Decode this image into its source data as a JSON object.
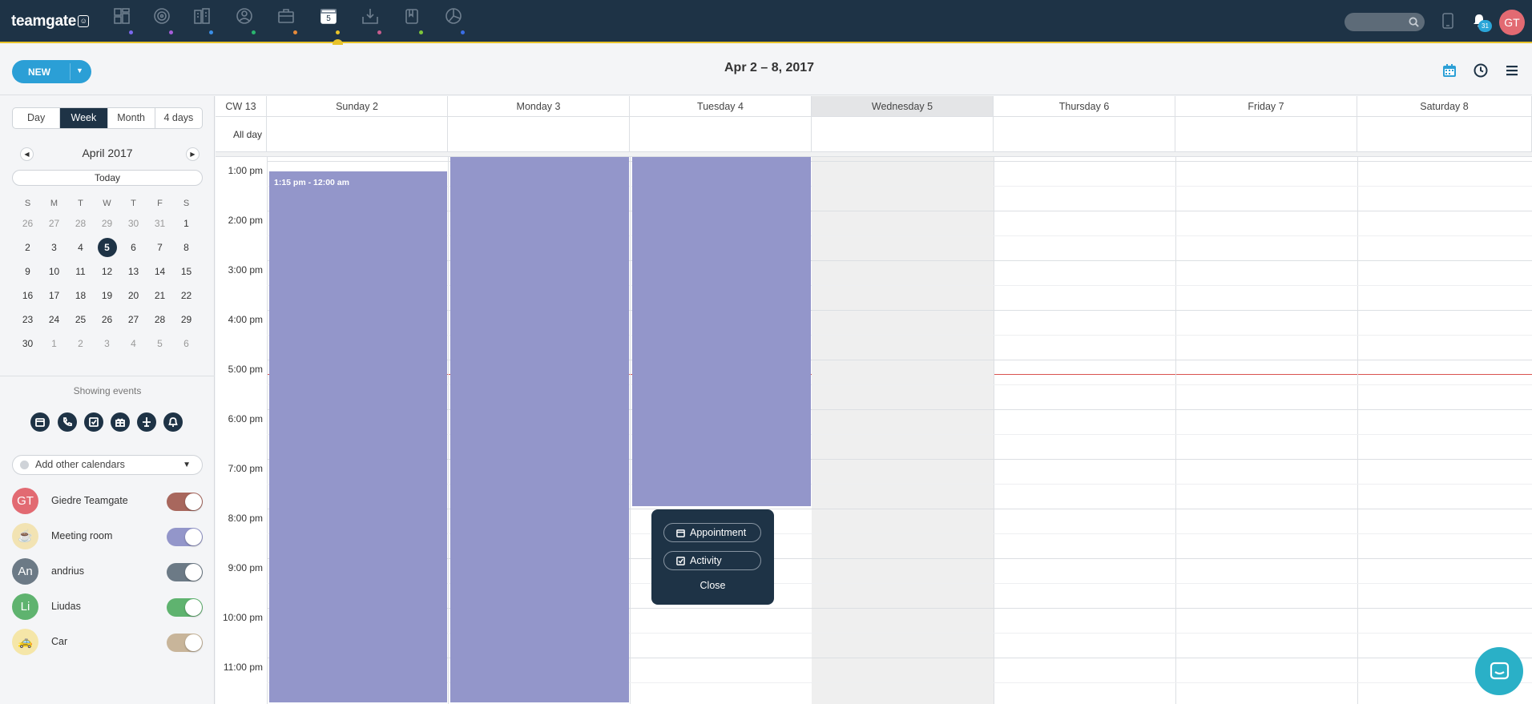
{
  "app": {
    "logo": "teamgate",
    "logo_badge": "☺"
  },
  "nav": {
    "icons": [
      {
        "name": "dashboard-icon",
        "dot": "#7b68ee"
      },
      {
        "name": "target-icon",
        "dot": "#a65edb"
      },
      {
        "name": "companies-icon",
        "dot": "#3a8ee6"
      },
      {
        "name": "people-icon",
        "dot": "#2ab56f"
      },
      {
        "name": "deals-icon",
        "dot": "#e68a3a"
      },
      {
        "name": "calendar-icon",
        "dot": "#e8c32a",
        "label": "5"
      },
      {
        "name": "inbox-icon",
        "dot": "#c75d8e"
      },
      {
        "name": "documents-icon",
        "dot": "#7fc63a"
      },
      {
        "name": "reports-icon",
        "dot": "#3a6ee6"
      }
    ],
    "notifications_count": "31",
    "user_initials": "GT"
  },
  "toolbar": {
    "new_label": "NEW",
    "range_title": "Apr 2 – 8, 2017"
  },
  "sidebar": {
    "views": [
      "Day",
      "Week",
      "Month",
      "4 days"
    ],
    "active_view": "Week",
    "month_title": "April 2017",
    "today_label": "Today",
    "weekday_heads": [
      "S",
      "M",
      "T",
      "W",
      "T",
      "F",
      "S"
    ],
    "weeks": [
      [
        "26",
        "27",
        "28",
        "29",
        "30",
        "31",
        "1"
      ],
      [
        "2",
        "3",
        "4",
        "5",
        "6",
        "7",
        "8"
      ],
      [
        "9",
        "10",
        "11",
        "12",
        "13",
        "14",
        "15"
      ],
      [
        "16",
        "17",
        "18",
        "19",
        "20",
        "21",
        "22"
      ],
      [
        "23",
        "24",
        "25",
        "26",
        "27",
        "28",
        "29"
      ],
      [
        "30",
        "1",
        "2",
        "3",
        "4",
        "5",
        "6"
      ]
    ],
    "selected_day": "5",
    "showing_events_label": "Showing events",
    "event_filters": [
      "calendar-icon",
      "phone-icon",
      "check-icon",
      "gift-icon",
      "plane-icon",
      "bell-icon"
    ],
    "add_calendars_label": "Add other calendars",
    "calendars": [
      {
        "initials": "GT",
        "name": "Giedre Teamgate",
        "avatar_color": "#e26a72",
        "toggle_color": "#a8675d"
      },
      {
        "initials": "☕",
        "name": "Meeting room",
        "avatar_color": "#f2e3b3",
        "toggle_color": "#9396ca"
      },
      {
        "initials": "An",
        "name": "andrius",
        "avatar_color": "#6c7a86",
        "toggle_color": "#6c7a86"
      },
      {
        "initials": "Li",
        "name": "Liudas",
        "avatar_color": "#5fb36f",
        "toggle_color": "#5fb36f"
      },
      {
        "initials": "🚕",
        "name": "Car",
        "avatar_color": "#f5e6a8",
        "toggle_color": "#c8b59a"
      }
    ]
  },
  "calendar": {
    "week_label": "CW 13",
    "all_day_label": "All day",
    "days": [
      "Sunday 2",
      "Monday 3",
      "Tuesday 4",
      "Wednesday 5",
      "Thursday 6",
      "Friday 7",
      "Saturday 8"
    ],
    "today_index": 3,
    "times": [
      "1:00 pm",
      "2:00 pm",
      "3:00 pm",
      "4:00 pm",
      "5:00 pm",
      "6:00 pm",
      "7:00 pm",
      "8:00 pm",
      "9:00 pm",
      "10:00 pm",
      "11:00 pm"
    ],
    "events": [
      {
        "day": 0,
        "label": "1:15 pm - 12:00 am"
      },
      {
        "day": 1,
        "label": ""
      },
      {
        "day": 2,
        "label": ""
      }
    ],
    "event_color": "#9396ca"
  },
  "popup": {
    "appointment_label": "Appointment",
    "activity_label": "Activity",
    "close_label": "Close"
  }
}
